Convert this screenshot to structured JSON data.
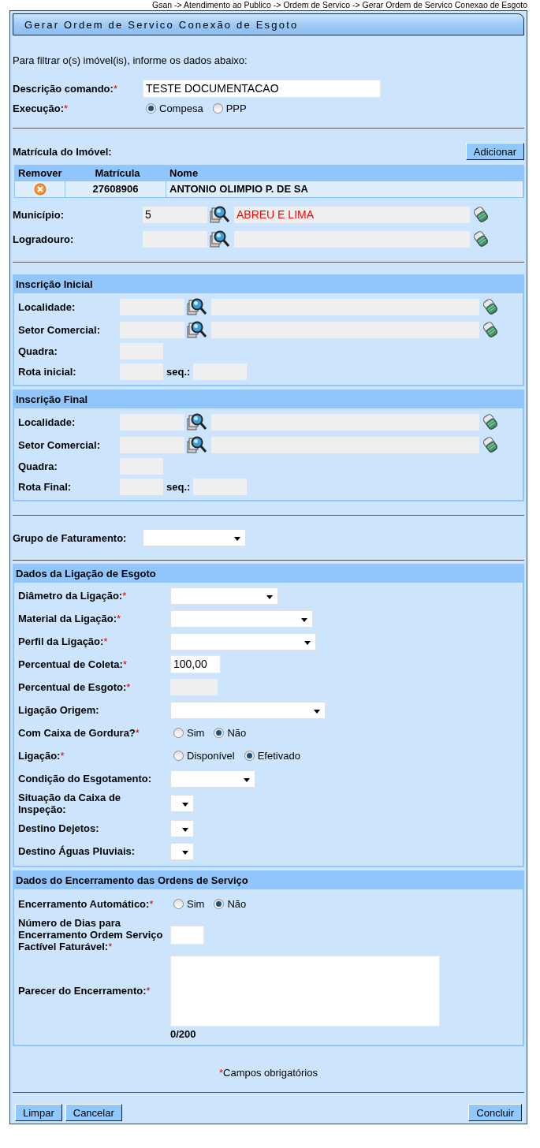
{
  "breadcrumb": "Gsan -> Atendimento ao Publico -> Ordem de Servico -> Gerar Ordem de Servico Conexao de Esgoto",
  "title": "Gerar Ordem de Servico Conexão de Esgoto",
  "intro": "Para filtrar o(s) imóvel(is), informe os dados abaixo:",
  "required_mark": "*",
  "descricao": {
    "label": "Descrição comando:",
    "required": true,
    "value": "TESTE DOCUMENTACAO"
  },
  "execucao": {
    "label": "Execução:",
    "required": true,
    "options": [
      {
        "label": "Compesa",
        "selected": true
      },
      {
        "label": "PPP",
        "selected": false
      }
    ]
  },
  "matricula": {
    "label": "Matrícula do Imóvel:",
    "add_button": "Adicionar",
    "columns": [
      "Remover",
      "Matrícula",
      "Nome"
    ],
    "rows": [
      {
        "matricula": "27608906",
        "nome": "ANTONIO OLIMPIO P. DE SA"
      }
    ]
  },
  "municipio": {
    "label": "Município:",
    "code": "5",
    "name": "ABREU E LIMA"
  },
  "logradouro": {
    "label": "Logradouro:"
  },
  "inscricao_inicial": {
    "title": "Inscrição Inicial",
    "rows": [
      {
        "kind": "lookup",
        "label": "Localidade:"
      },
      {
        "kind": "lookup",
        "label": "Setor Comercial:"
      },
      {
        "kind": "short",
        "label": "Quadra:"
      },
      {
        "kind": "rota",
        "label": "Rota inicial:",
        "seq_label": "seq.:"
      }
    ]
  },
  "inscricao_final": {
    "title": "Inscrição Final",
    "rows": [
      {
        "kind": "lookup",
        "label": "Localidade:"
      },
      {
        "kind": "lookup",
        "label": "Setor Comercial:"
      },
      {
        "kind": "short",
        "label": "Quadra:"
      },
      {
        "kind": "rota",
        "label": "Rota Final:",
        "seq_label": "seq.:"
      }
    ]
  },
  "grupo_faturamento": {
    "label": "Grupo de Faturamento:"
  },
  "ligacao": {
    "title": "Dados da Ligação de Esgoto",
    "rows": [
      {
        "kind": "select",
        "label": "Diâmetro da Ligação:",
        "required": true
      },
      {
        "kind": "select",
        "label": "Material da Ligação:",
        "required": true
      },
      {
        "kind": "select",
        "label": "Perfil da Ligação:",
        "required": true
      },
      {
        "kind": "text",
        "label": "Percentual de Coleta:",
        "required": true,
        "value": "100,00"
      },
      {
        "kind": "readonly",
        "label": "Percentual de Esgoto:",
        "required": true
      },
      {
        "kind": "select",
        "label": "Ligação Origem:",
        "required": false
      },
      {
        "kind": "radio",
        "label": "Com Caixa de Gordura?",
        "required": true,
        "options": [
          {
            "label": "Sim",
            "selected": false
          },
          {
            "label": "Não",
            "selected": true
          }
        ]
      },
      {
        "kind": "radio",
        "label": "Ligação:",
        "required": true,
        "options": [
          {
            "label": "Disponível",
            "selected": false
          },
          {
            "label": "Efetivado",
            "selected": true
          }
        ]
      },
      {
        "kind": "select",
        "label": "Condição do Esgotamento:",
        "required": false
      },
      {
        "kind": "select",
        "label": "Situação da Caixa de Inspeção:",
        "required": false
      },
      {
        "kind": "select",
        "label": "Destino Dejetos:",
        "required": false
      },
      {
        "kind": "select",
        "label": "Destino Águas Pluviais:",
        "required": false
      }
    ]
  },
  "encerramento": {
    "title": "Dados do Encerramento das Ordens de Serviço",
    "rows": [
      {
        "kind": "radio",
        "label": "Encerramento Automático:",
        "required": true,
        "options": [
          {
            "label": "Sim",
            "selected": false
          },
          {
            "label": "Não",
            "selected": true
          }
        ]
      },
      {
        "kind": "text",
        "label": "Número de Dias para Encerramento Ordem Serviço Factível Faturável:",
        "required": true
      },
      {
        "kind": "textarea",
        "label": "Parecer do Encerramento:",
        "required": true,
        "counter": "0/200"
      }
    ]
  },
  "required_note": "Campos obrigatórios",
  "buttons_left": [
    "Limpar",
    "Cancelar"
  ],
  "buttons_right": [
    "Concluir"
  ]
}
